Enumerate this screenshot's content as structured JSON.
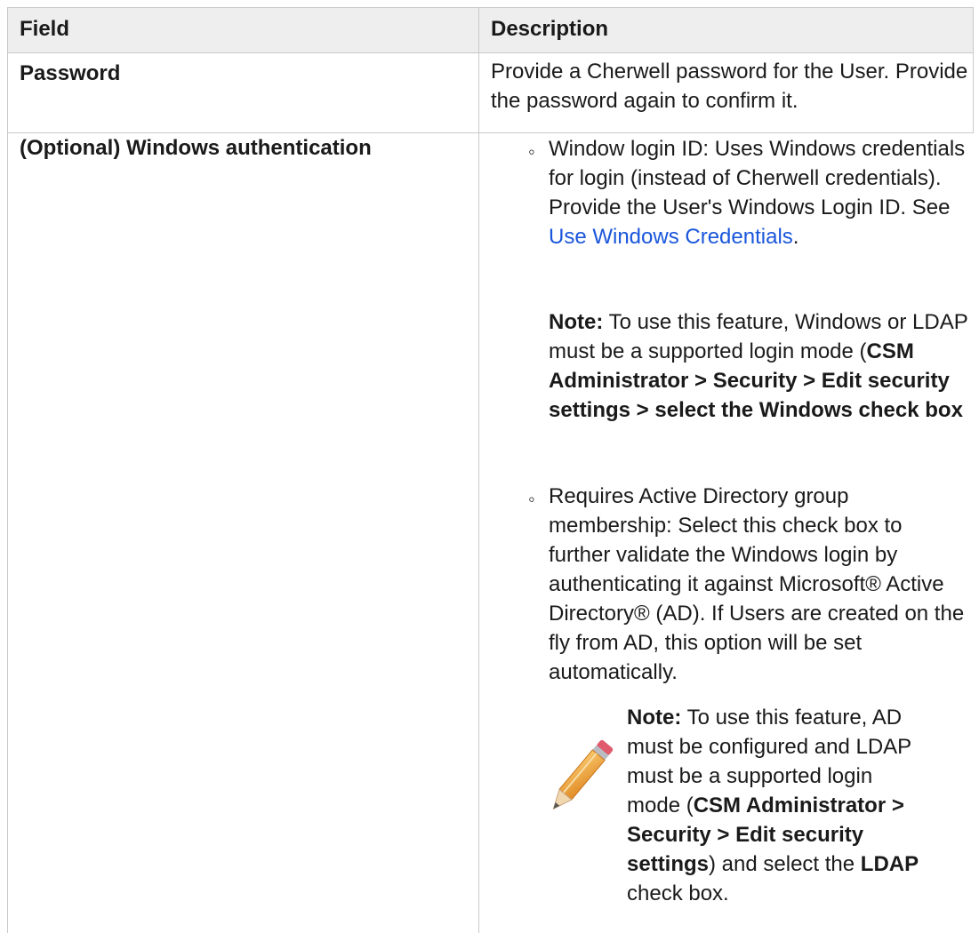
{
  "table": {
    "headers": {
      "field": "Field",
      "description": "Description"
    },
    "rows": [
      {
        "field": "Password",
        "description": "Provide a Cherwell password for the User. Provide the password again to confirm it."
      },
      {
        "field": "(Optional) Windows authentication",
        "items": [
          {
            "text_before_link": "Window login ID: Uses Windows credentials for login (instead of Cherwell credentials). Provide the User's Windows Login ID. See ",
            "link": "Use Windows Credentials",
            "text_after_link": ".",
            "note_label": "Note:",
            "note_text": " To use this feature, Windows or LDAP must be a supported login mode (",
            "note_path": "CSM Administrator > Security > Edit security settings > select the Windows check box"
          },
          {
            "text": "Requires Active Directory group membership: Select this check box to further validate the Windows login by authenticating it against Microsoft® Active Directory® (AD). If Users are created on the fly from AD, this option will be set automatically.",
            "note_label": "Note:",
            "note_text_1": " To use this feature, AD must be configured and LDAP must be a supported login mode (",
            "note_path": "CSM Administrator > Security > Edit security settings",
            "note_text_2": ") and select the ",
            "note_ldap": "LDAP",
            "note_text_3": " check box.",
            "note_icon": "pencil-icon"
          }
        ]
      }
    ]
  }
}
